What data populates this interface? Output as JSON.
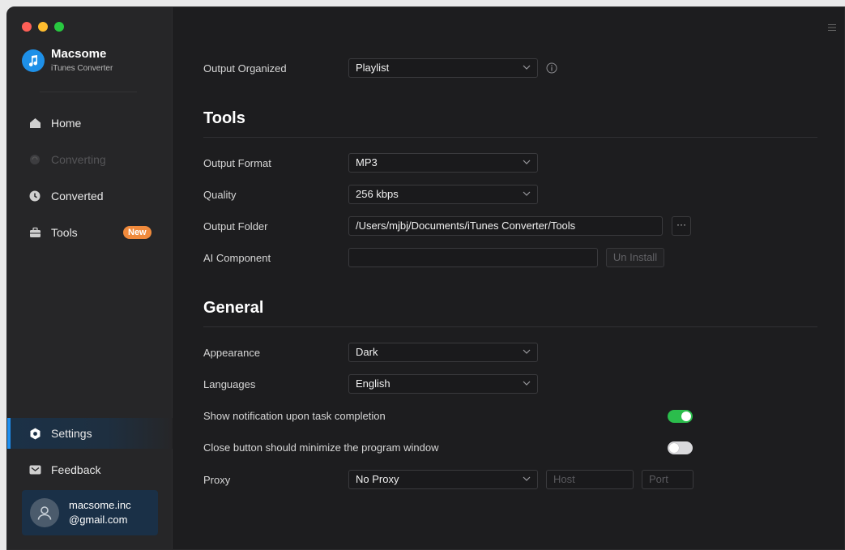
{
  "app": {
    "name": "Macsome",
    "subtitle": "iTunes Converter"
  },
  "sidebar": {
    "items": [
      {
        "label": "Home",
        "icon": "home-icon",
        "state": "normal"
      },
      {
        "label": "Converting",
        "icon": "converting-icon",
        "state": "disabled"
      },
      {
        "label": "Converted",
        "icon": "clock-icon",
        "state": "normal"
      },
      {
        "label": "Tools",
        "icon": "toolbox-icon",
        "state": "normal",
        "badge": "New"
      }
    ],
    "bottom_items": [
      {
        "label": "Settings",
        "icon": "settings-icon",
        "state": "active"
      },
      {
        "label": "Feedback",
        "icon": "mail-icon",
        "state": "normal"
      }
    ],
    "account": {
      "line1": "macsome.inc",
      "line2": "@gmail.com"
    }
  },
  "settings": {
    "output_organized": {
      "label": "Output Organized",
      "value": "Playlist"
    },
    "tools": {
      "title": "Tools",
      "output_format": {
        "label": "Output Format",
        "value": "MP3"
      },
      "quality": {
        "label": "Quality",
        "value": "256 kbps"
      },
      "output_folder": {
        "label": "Output Folder",
        "value": "/Users/mjbj/Documents/iTunes Converter/Tools",
        "browse_label": "···"
      },
      "ai_component": {
        "label": "AI Component",
        "value": "",
        "button": "Un Install"
      }
    },
    "general": {
      "title": "General",
      "appearance": {
        "label": "Appearance",
        "value": "Dark"
      },
      "languages": {
        "label": "Languages",
        "value": "English"
      },
      "notification": {
        "label": "Show notification upon task completion",
        "enabled": true
      },
      "close_minimize": {
        "label": "Close button should minimize the program window",
        "enabled": false
      },
      "proxy": {
        "label": "Proxy",
        "value": "No Proxy",
        "host_placeholder": "Host",
        "port_placeholder": "Port"
      }
    }
  },
  "colors": {
    "accent": "#1e8ff0",
    "toggle_on": "#2bbd4c",
    "badge": "#f08a3c"
  }
}
